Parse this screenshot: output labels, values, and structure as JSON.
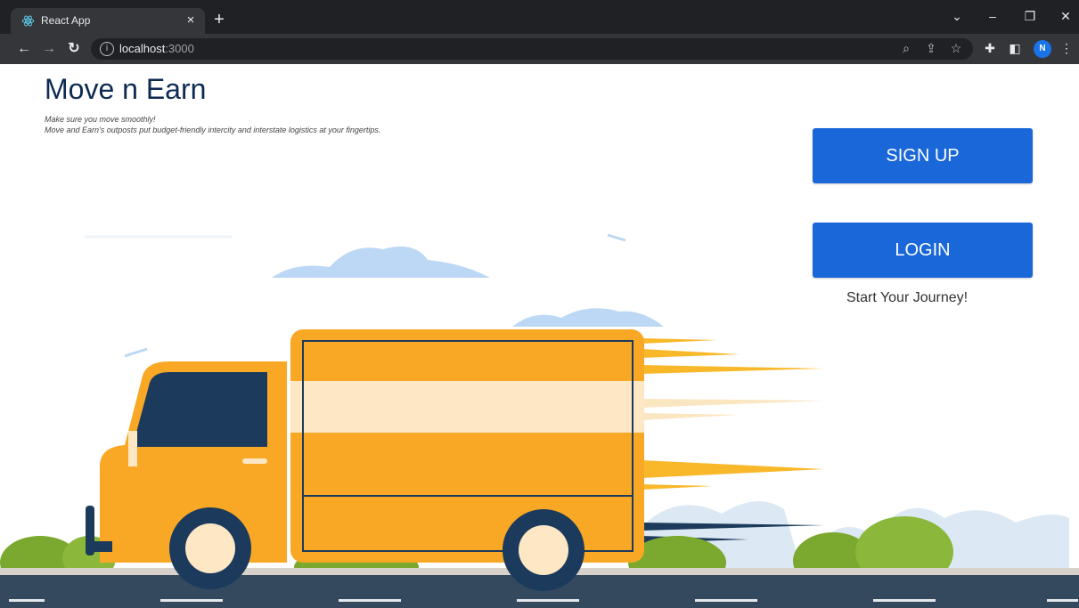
{
  "browser": {
    "tab_title": "React App",
    "tab_close": "×",
    "new_tab": "+",
    "url_host": "localhost",
    "url_port": ":3000",
    "profile_initial": "N",
    "window_controls": {
      "chevron": "⌄",
      "minimize": "–",
      "restore": "❐",
      "close": "✕"
    }
  },
  "page": {
    "title": "Move n Earn",
    "tagline_1": "Make sure you move smoothly!",
    "tagline_2": "Move and Earn's outposts put budget-friendly intercity and interstate logistics at your fingertips.",
    "signup_label": "SIGN UP",
    "login_label": "LOGIN",
    "journey_text": "Start Your Journey!"
  },
  "colors": {
    "primary": "#1967d8",
    "title": "#0d2a52",
    "truck_body": "#f9a825",
    "truck_dark": "#1b3a5c",
    "road": "#34495e",
    "cloud": "#bcd8f5",
    "bush": "#7ba82e"
  }
}
